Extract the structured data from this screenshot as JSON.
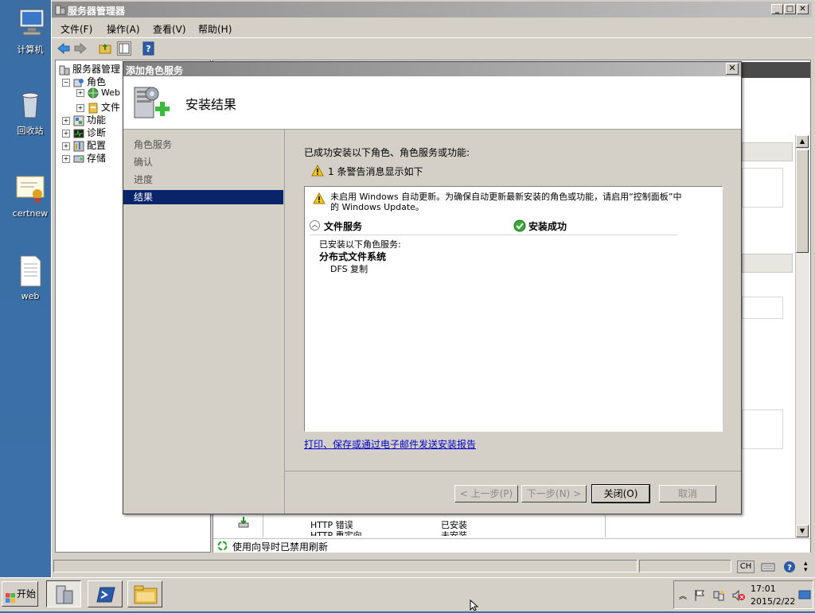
{
  "desktop": {
    "icons": [
      {
        "label": "计算机"
      },
      {
        "label": "回收站"
      },
      {
        "label": "certnew"
      },
      {
        "label": "web"
      }
    ]
  },
  "main_window": {
    "title": "服务器管理器",
    "menus": [
      "文件(F)",
      "操作(A)",
      "查看(V)",
      "帮助(H)"
    ],
    "tree": {
      "root": "服务器管理",
      "roles": "角色",
      "web": "Web",
      "file": "文件",
      "features": "功能",
      "diagnostics": "诊断",
      "configuration": "配置",
      "storage": "存储"
    },
    "bg_rows": [
      {
        "name": "HTTP 错误",
        "status": "已安装"
      },
      {
        "name": "HTTP 重定向",
        "status": "未安装"
      }
    ],
    "status_refresh": "使用向导时已禁用刷新"
  },
  "dialog": {
    "title": "添加角色服务",
    "heading": "安装结果",
    "nav": [
      {
        "label": "角色服务",
        "selected": false
      },
      {
        "label": "确认",
        "selected": false
      },
      {
        "label": "进度",
        "selected": false
      },
      {
        "label": "结果",
        "selected": true
      }
    ],
    "intro": "已成功安装以下角色、角色服务或功能:",
    "warning_count": "1 条警告消息显示如下",
    "warning_line1": "未启用 Windows 自动更新。为确保自动更新最新安装的角色或功能，请启用“控制面板”中",
    "warning_line2": "的 Windows Update。",
    "section_title": "文件服务",
    "section_status": "安装成功",
    "installed_label": "已安装以下角色服务:",
    "installed_group": "分布式文件系统",
    "installed_item": "DFS 复制",
    "report_link": "打印、保存或通过电子邮件发送安装报告",
    "buttons": {
      "back": "< 上一步(P)",
      "next": "下一步(N) >",
      "close": "关闭(O)",
      "cancel": "取消"
    }
  },
  "taskbar": {
    "start": "开始",
    "lang": "CH",
    "time": "17:01",
    "date": "2015/2/22"
  },
  "colors": {
    "desktop": "#3a6ea5",
    "selection": "#0a246a",
    "link": "#0000cc"
  }
}
